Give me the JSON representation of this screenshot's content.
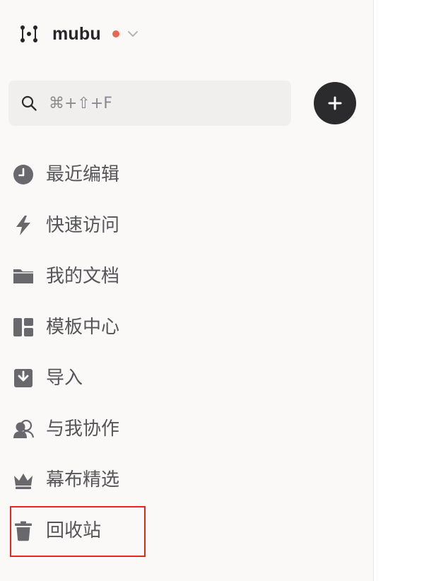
{
  "brand": {
    "name": "mubu",
    "logo_icon": "mubu-logo-icon",
    "status_color": "#e8684f",
    "chevron_icon": "chevron-down-icon"
  },
  "search": {
    "icon": "search-icon",
    "shortcut": "⌘+⇧+F"
  },
  "add_button": {
    "icon": "plus-icon"
  },
  "sidebar": {
    "items": [
      {
        "label": "最近编辑",
        "icon": "clock-icon"
      },
      {
        "label": "快速访问",
        "icon": "lightning-icon"
      },
      {
        "label": "我的文档",
        "icon": "folder-icon"
      },
      {
        "label": "模板中心",
        "icon": "template-grid-icon"
      },
      {
        "label": "导入",
        "icon": "import-icon"
      },
      {
        "label": "与我协作",
        "icon": "collaborators-icon"
      },
      {
        "label": "幕布精选",
        "icon": "crown-icon"
      },
      {
        "label": "回收站",
        "icon": "trash-icon"
      }
    ]
  },
  "annotation": {
    "highlight_color": "#e8261f",
    "highlighted_item": "回收站"
  }
}
